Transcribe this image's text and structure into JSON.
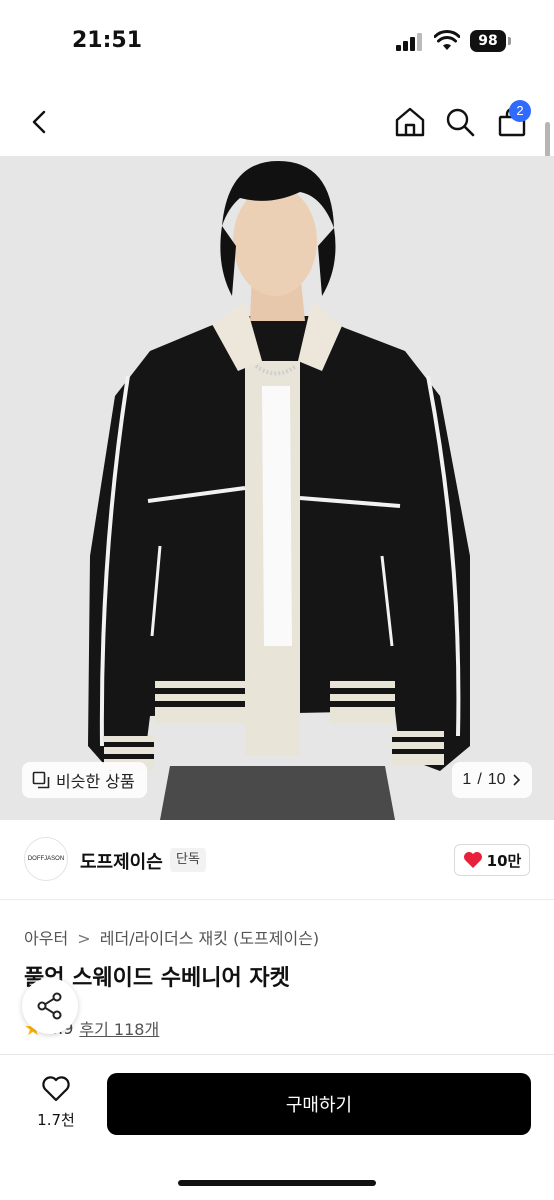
{
  "status_bar": {
    "time": "21:51",
    "battery": "98"
  },
  "nav": {
    "cart_count": "2"
  },
  "gallery": {
    "similar_label": "비슷한 상품",
    "page_current": "1",
    "page_total": "10"
  },
  "brand": {
    "logo_text": "DOFFJASON",
    "name": "도프제이슨",
    "tag": "단독",
    "likes": "10만"
  },
  "product": {
    "breadcrumb": [
      "아우터",
      "레더/라이더스 재킷 (도프제이슨)"
    ],
    "title": "풀업 스웨이드 수베니어 자켓",
    "rating": "4.9",
    "reviews_label": "후기 118개"
  },
  "bottom": {
    "wish_count": "1.7천",
    "buy_label": "구매하기"
  },
  "colors": {
    "accent": "#2f6bff",
    "like_heart": "#e8203a",
    "star": "#ffb400",
    "buy_button": "#000000"
  }
}
